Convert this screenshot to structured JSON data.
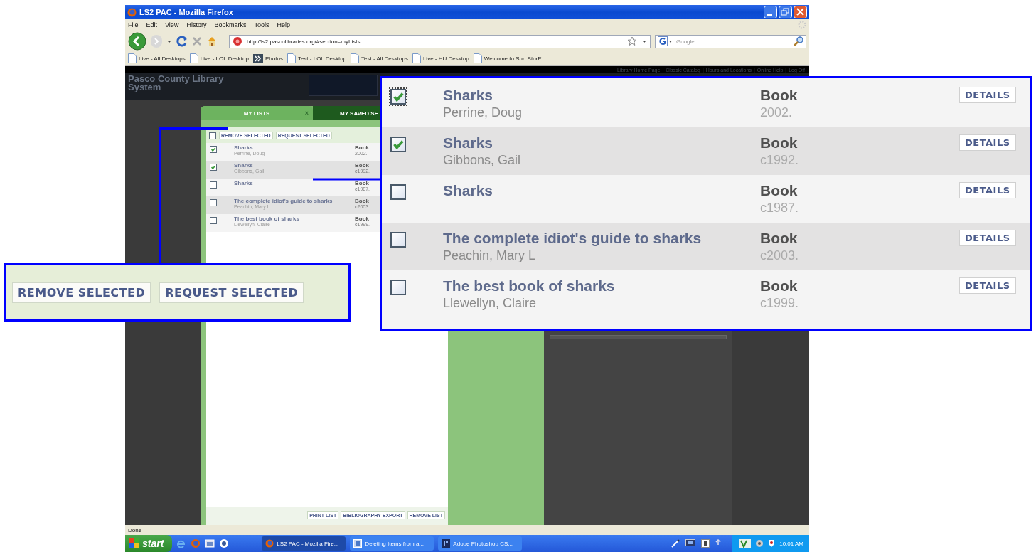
{
  "window": {
    "title": "LS2 PAC - Mozilla Firefox"
  },
  "menu": [
    "File",
    "Edit",
    "View",
    "History",
    "Bookmarks",
    "Tools",
    "Help"
  ],
  "address_bar": {
    "value": "http://ls2.pascolibraries.org/#section=myLists"
  },
  "search": {
    "placeholder": "Google"
  },
  "bookmarks": [
    {
      "label": "Live - All Desktops",
      "kind": "page"
    },
    {
      "label": "Live - LOL Desktop",
      "kind": "page"
    },
    {
      "label": "Photos",
      "kind": "feed"
    },
    {
      "label": "Test - LOL Desktop",
      "kind": "page"
    },
    {
      "label": "Test - All Desktops",
      "kind": "page"
    },
    {
      "label": "Live - HU Desktop",
      "kind": "page"
    },
    {
      "label": "Welcome to Sun StorE...",
      "kind": "page"
    }
  ],
  "site": {
    "name": "Pasco County Library System",
    "separator": "|",
    "links": [
      "Library Home Page",
      "Classic Catalog",
      "Hours and Locations",
      "Online Help",
      "Log Off"
    ]
  },
  "tabs": [
    {
      "label": "MY LISTS",
      "close": "×",
      "selected": true
    },
    {
      "label": "MY SAVED SE",
      "selected": false
    }
  ],
  "list": {
    "select_all": {
      "checked": false
    },
    "actions": [
      "REMOVE SELECTED",
      "REQUEST SELECTED"
    ],
    "items": [
      {
        "title": "Sharks",
        "author": "Perrine, Doug",
        "format": "Book",
        "year": "2002.",
        "checked": true
      },
      {
        "title": "Sharks",
        "author": "Gibbons, Gail",
        "format": "Book",
        "year": "c1992.",
        "checked": true
      },
      {
        "title": "Sharks",
        "format": "Book",
        "year": "c1987.",
        "checked": false
      },
      {
        "title": "The complete idiot's guide to sharks",
        "author": "Peachin, Mary L",
        "format": "Book",
        "year": "c2003.",
        "checked": false
      },
      {
        "title": "The best book of sharks",
        "author": "Llewellyn, Claire",
        "format": "Book",
        "year": "c1999.",
        "checked": false
      }
    ],
    "footer_actions": [
      "PRINT LIST",
      "BIBLIOGRAPHY EXPORT",
      "REMOVE LIST"
    ]
  },
  "callouts": [
    {
      "kind": "actions",
      "actions": [
        "REMOVE SELECTED",
        "REQUEST SELECTED"
      ]
    },
    {
      "kind": "items",
      "items": [
        {
          "title": "Sharks",
          "author": "Perrine, Doug",
          "format": "Book",
          "year": "2002.",
          "details": "DETAILS",
          "checked": true,
          "focused": true
        },
        {
          "title": "Sharks",
          "author": "Gibbons, Gail",
          "format": "Book",
          "year": "c1992.",
          "details": "DETAILS",
          "checked": true,
          "focused": false
        },
        {
          "title": "Sharks",
          "format": "Book",
          "year": "c1987.",
          "details": "DETAILS",
          "checked": false,
          "focused": false
        },
        {
          "title": "The complete idiot's guide to sharks",
          "author": "Peachin, Mary L",
          "format": "Book",
          "year": "c2003.",
          "details": "DETAILS",
          "checked": false,
          "focused": false
        },
        {
          "title": "The best book of sharks",
          "author": "Llewellyn, Claire",
          "format": "Book",
          "year": "c1999.",
          "details": "DETAILS",
          "checked": false,
          "focused": false
        }
      ]
    }
  ],
  "status_bar": "Done",
  "taskbar": {
    "start": "start",
    "tasks": [
      {
        "label": "LS2 PAC - Mozilla Fire...",
        "kind": "browser",
        "selected": true
      },
      {
        "label": "Deleting Items from a...",
        "kind": "document",
        "selected": false
      },
      {
        "label": "Adobe Photoshop CS...",
        "kind": "photoshop",
        "selected": false
      }
    ],
    "clock": "10:01 AM"
  }
}
